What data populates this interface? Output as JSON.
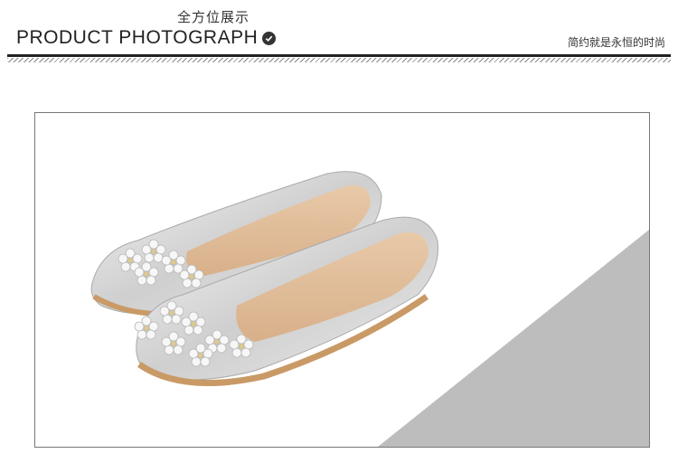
{
  "header": {
    "title_cn": "全方位展示",
    "title_en": "PRODUCT PHOTOGRAPH",
    "tagline": "简约就是永恒的时尚"
  },
  "photo": {
    "subject": "silver ballet flats with crystal flower embellishments"
  }
}
